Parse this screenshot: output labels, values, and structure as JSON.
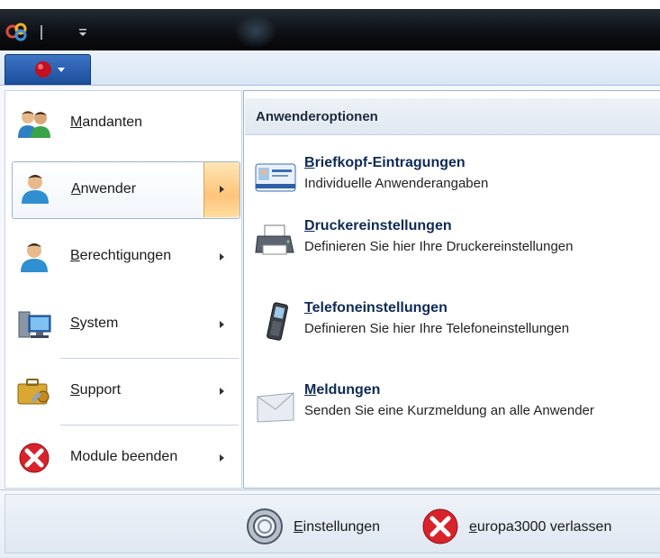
{
  "menu": {
    "items": [
      {
        "key": "M",
        "rest": "andanten",
        "icon": "users-icon",
        "has_submenu": false
      },
      {
        "key": "A",
        "rest": "nwender",
        "icon": "user-icon",
        "has_submenu": true,
        "selected": true
      },
      {
        "key": "B",
        "rest": "erechtigungen",
        "icon": "user-permissions-icon",
        "has_submenu": true
      },
      {
        "key": "S",
        "rest": "ystem",
        "icon": "computer-system-icon",
        "has_submenu": true
      },
      {
        "key": "S",
        "rest": "upport",
        "icon": "support-briefcase-icon",
        "has_submenu": true
      },
      {
        "key": "",
        "rest": "Module beenden",
        "icon": "close-red-icon",
        "has_submenu": true
      }
    ]
  },
  "options": {
    "header": "Anwenderoptionen",
    "items": [
      {
        "key": "B",
        "rest": "riefkopf-Eintragungen",
        "desc": "Individuelle Anwenderangaben",
        "icon": "id-card-icon"
      },
      {
        "key": "D",
        "rest": "ruckereinstellungen",
        "desc": "Definieren Sie hier Ihre Druckereinstellungen",
        "icon": "printer-icon"
      },
      {
        "key": "T",
        "rest": "elefoneinstellungen",
        "desc": "Definieren Sie hier Ihre Telefoneinstellungen",
        "icon": "phone-icon"
      },
      {
        "key": "M",
        "rest": "eldungen",
        "desc": "Senden Sie eine Kurzmeldung an alle Anwender",
        "icon": "envelope-icon"
      }
    ]
  },
  "footer": {
    "settings": {
      "key": "E",
      "rest": "instellungen",
      "icon": "settings-ring-icon"
    },
    "exit": {
      "key": "e",
      "rest": "uropa3000 verlassen",
      "icon": "exit-red-icon"
    }
  },
  "colors": {
    "accent": "#1b4f9c",
    "highlight": "#ffc47a",
    "title_text": "#0f2a55"
  }
}
